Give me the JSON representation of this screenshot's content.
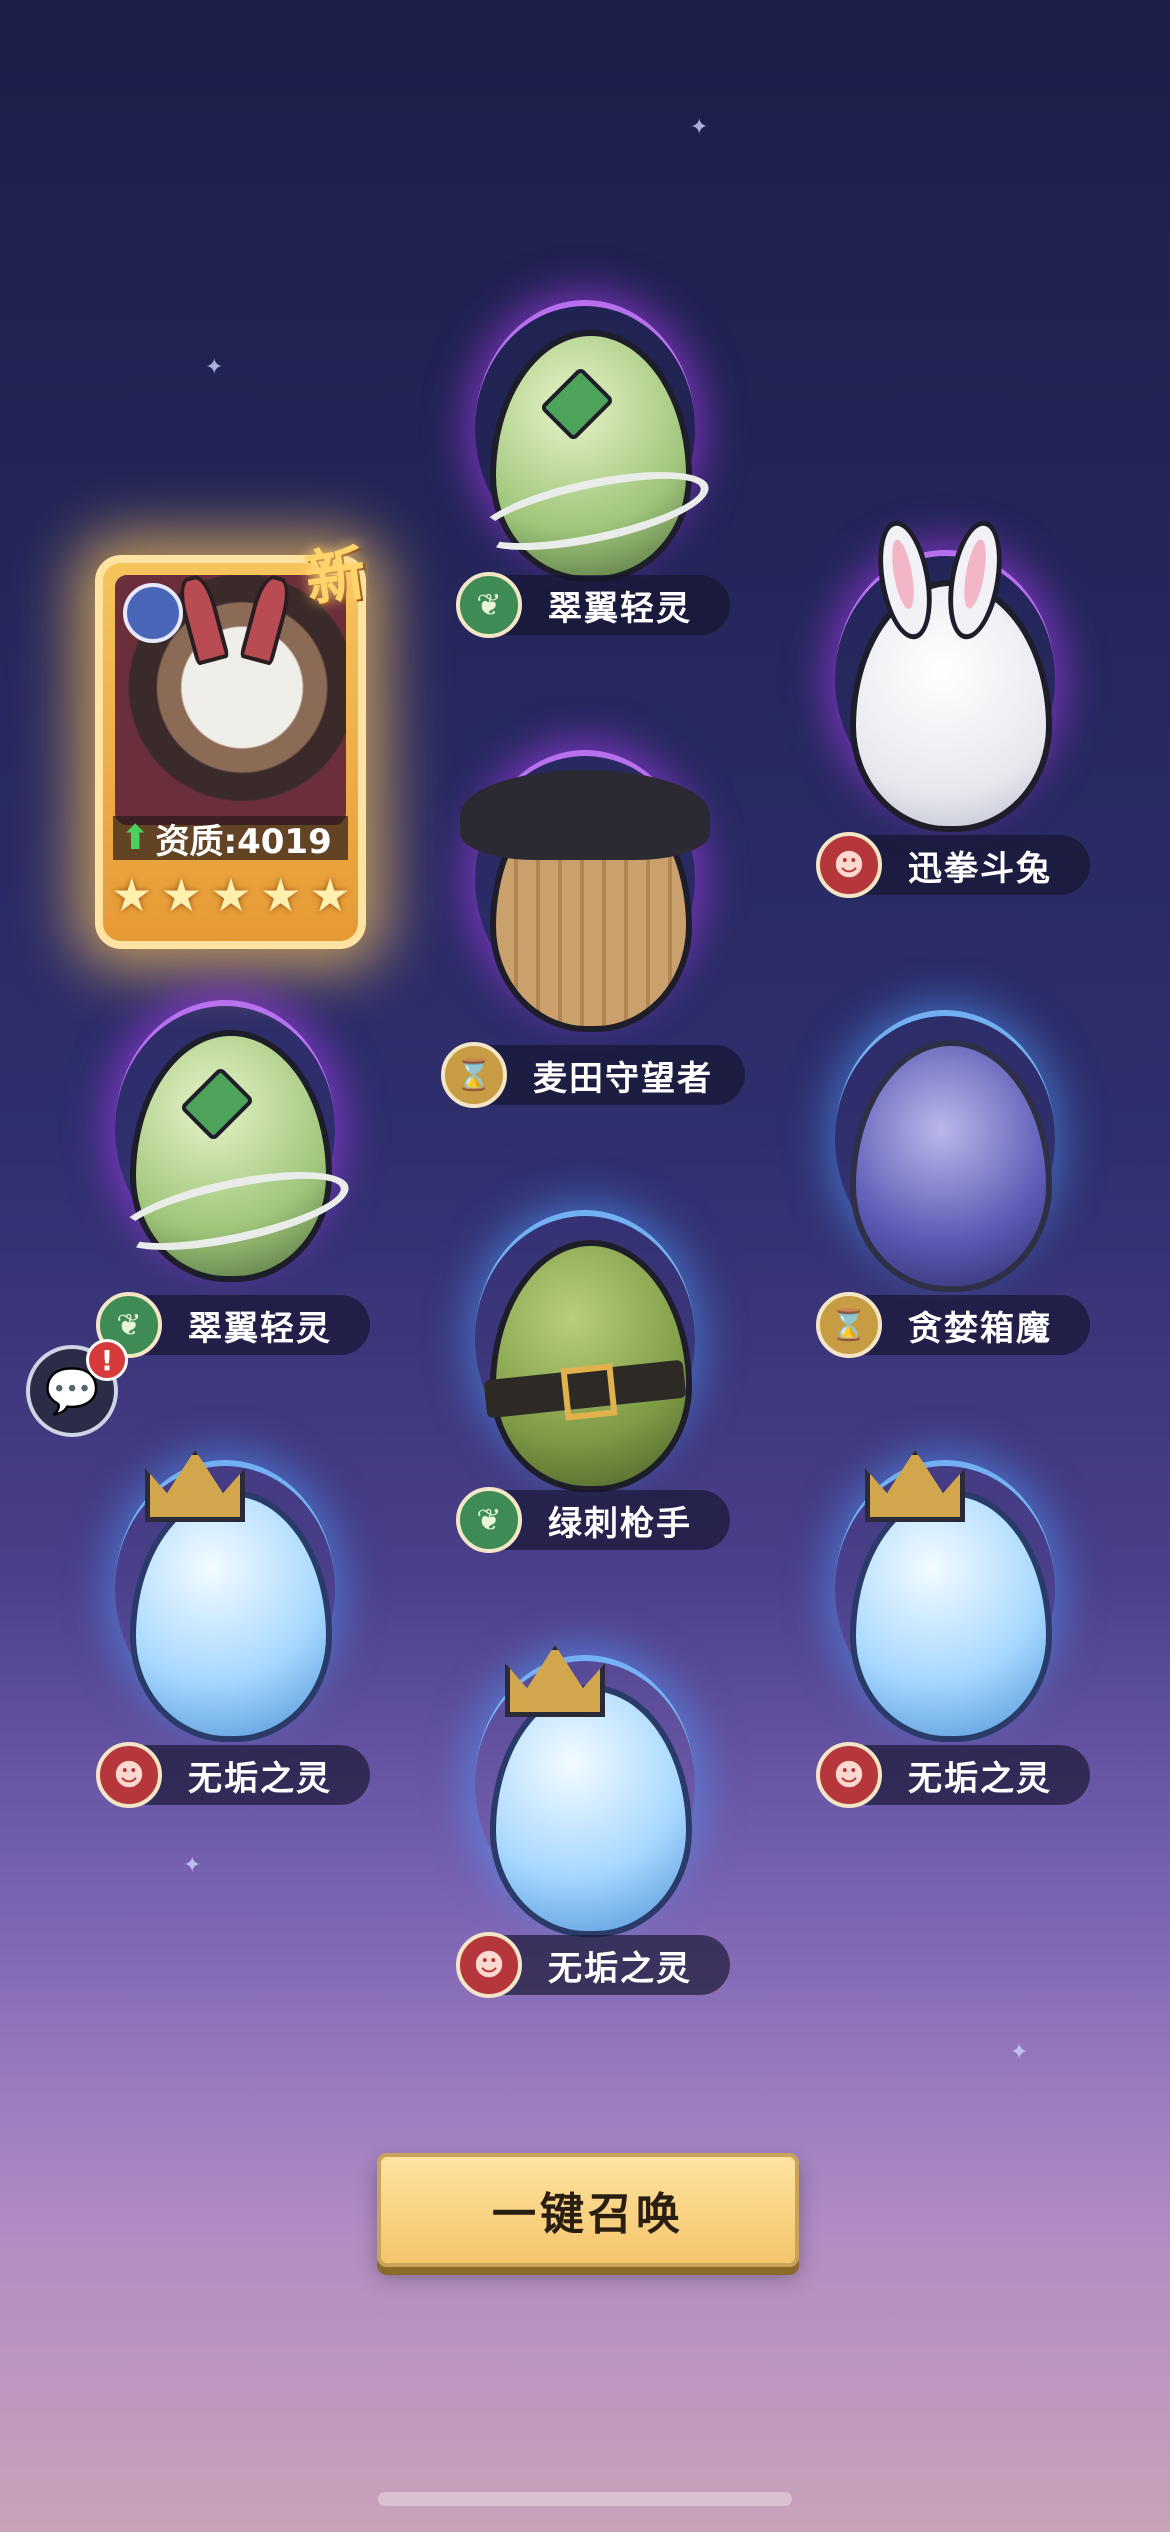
{
  "slots": [
    {
      "name": "翠翼轻灵",
      "badge": "nature-icon"
    },
    {
      "name": "迅拳斗兔",
      "badge": "demon-icon"
    },
    {
      "name": "麦田守望者",
      "badge": "order-icon"
    },
    {
      "name": "翠翼轻灵",
      "badge": "nature-icon"
    },
    {
      "name": "贪婪箱魔",
      "badge": "order-icon"
    },
    {
      "name": "绿刺枪手",
      "badge": "nature-icon"
    },
    {
      "name": "无垢之灵",
      "badge": "demon-icon"
    },
    {
      "name": "无垢之灵",
      "badge": "demon-icon"
    },
    {
      "name": "无垢之灵",
      "badge": "demon-icon"
    }
  ],
  "hero_card": {
    "aptitude_label": "资质:4019",
    "stars": 5,
    "new_tag": "新"
  },
  "summon_button": "一键召唤",
  "colors": {
    "rare_glow": "#aa3cf0",
    "common_glow": "#50a0ff",
    "button": "#f3c56b"
  }
}
